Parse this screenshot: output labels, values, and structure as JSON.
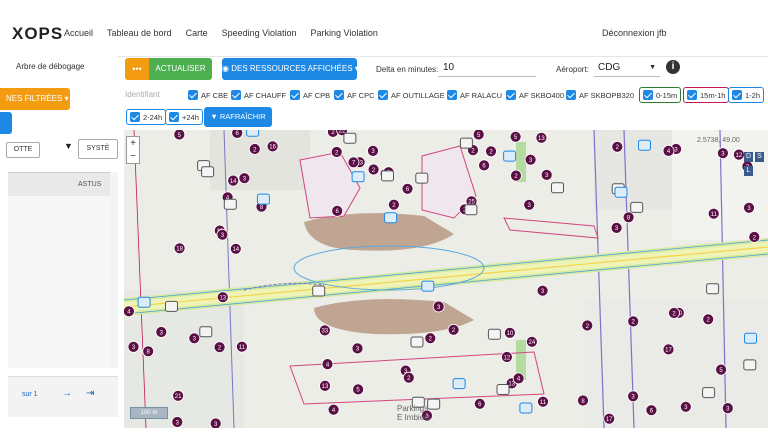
{
  "app": {
    "brand": "XOPS",
    "logout": "Déconnexion jfb"
  },
  "nav": [
    "Accueil",
    "Tableau de bord",
    "Carte",
    "Speeding Violation",
    "Parking Violation"
  ],
  "sidebar": {
    "debug_label": "Arbre de débogage",
    "filtered_button": "NES FILTRÉES ▾",
    "col_button_1": "OTTE",
    "col_button_2": "SYSTÈ",
    "status_col": "ASTUS",
    "pager": {
      "label": "sur 1",
      "next": "→",
      "last": "⇥"
    }
  },
  "toolbar": {
    "more_label": "•••",
    "refresh_label": "ACTUALISER",
    "resources_label": "◉ DES RESSOURCES AFFICHÉES ▾",
    "delta_label": "Delta en minutes:",
    "delta_value": "10",
    "airport_label": "Aéroport:",
    "airport_value": "CDG",
    "info": "i",
    "identifier_label": "Identifiant",
    "companies": [
      "AF CBE",
      "AF CHAUFF",
      "AF CPB",
      "AF CPC",
      "AF OUTILLAGE",
      "AF RALACU",
      "AF SKBO400",
      "AF SKBOPB320"
    ],
    "time_filters": [
      "0-15m",
      "15m-1h",
      "1-2h",
      "2-24h",
      "+24h"
    ],
    "time_colors": [
      "#2e7d32",
      "#c2185b",
      "#1e88e5",
      "#1e88e5",
      "#1e88e5"
    ],
    "apply_label": "▼ RAFRAÎCHIR"
  },
  "map": {
    "zoom_in": "+",
    "zoom_out": "−",
    "coords": "2.5738, 49.00",
    "scale": "100 m",
    "place_label_1": "Parkings",
    "place_label_2": "E Imbiers",
    "marker_numbers": [
      "4",
      "2",
      "2",
      "3",
      "11",
      "5",
      "3",
      "40",
      "2",
      "3",
      "5",
      "2",
      "8",
      "3",
      "12",
      "2",
      "18",
      "3",
      "3",
      "8",
      "3",
      "4",
      "6",
      "2",
      "3",
      "6",
      "2",
      "3",
      "3",
      "3",
      "2",
      "17",
      "12",
      "2",
      "2",
      "3",
      "21",
      "3",
      "8",
      "5",
      "6",
      "23",
      "6",
      "11",
      "3",
      "33",
      "24",
      "17",
      "3",
      "5",
      "25",
      "2",
      "4",
      "2",
      "11",
      "3",
      "5",
      "2",
      "3",
      "12",
      "13",
      "3",
      "2",
      "2",
      "16",
      "22",
      "13",
      "4",
      "2",
      "13",
      "13",
      "6",
      "8",
      "7",
      "2",
      "2",
      "3",
      "4",
      "10",
      "3",
      "14",
      "6",
      "3",
      "3",
      "3",
      "2",
      "4",
      "3",
      "14",
      "2",
      "5"
    ]
  }
}
